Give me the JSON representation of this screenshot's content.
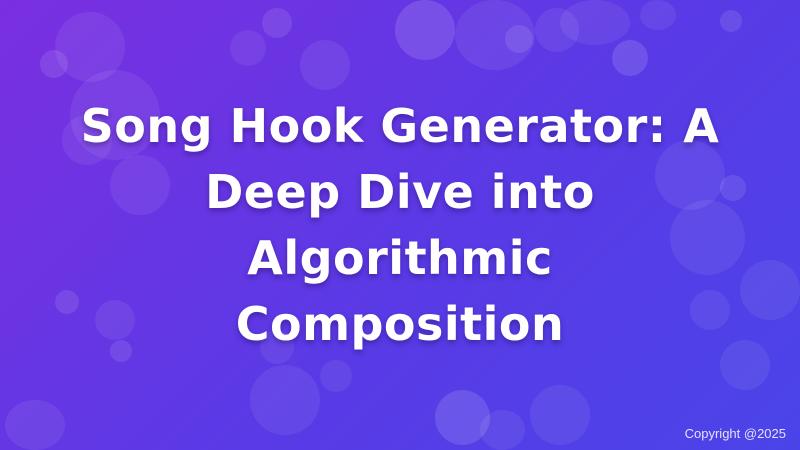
{
  "banner": {
    "title": "Song Hook Generator: A Deep Dive into Algorithmic Composition",
    "copyright": "Copyright @2025"
  },
  "colors": {
    "background_start": "#7a2fe0",
    "background_end": "#4a44e8",
    "text": "#ffffff"
  }
}
